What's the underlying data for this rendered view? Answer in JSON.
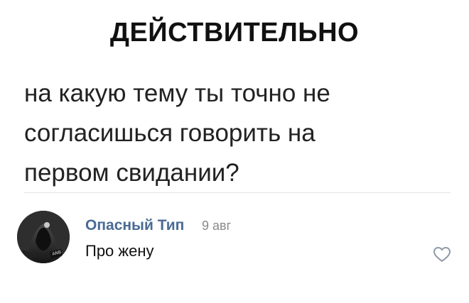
{
  "header": {
    "title": "ДЕЙСТВИТЕЛЬНО"
  },
  "post": {
    "lines": [
      "на какую тему ты точно не",
      "согласишься говорить на",
      "первом свидании?"
    ]
  },
  "comment": {
    "author": "Опасный Тип",
    "date": "9 авг",
    "text": "Про жену",
    "avatar_icon": "user-avatar",
    "like_icon": "heart-outline-icon"
  },
  "colors": {
    "author_link": "#4a6b94",
    "date": "#8a8a8a",
    "divider": "#e4e4e4",
    "like_icon": "#8f9aa8"
  }
}
